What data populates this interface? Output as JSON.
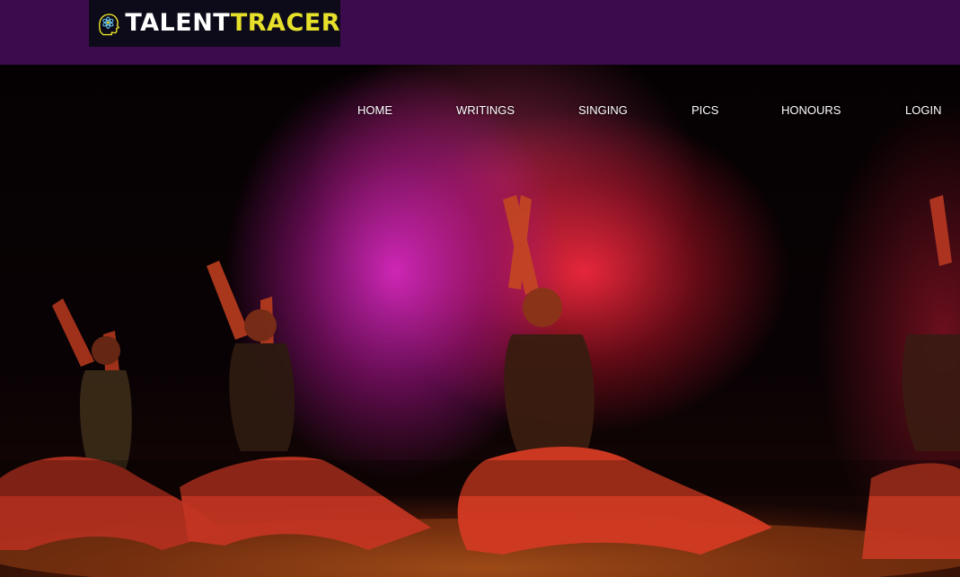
{
  "header": {
    "logo": {
      "text_part1": "TALENT",
      "text_part2": "TRACER",
      "icon": "head-atom-icon",
      "text_color": "#ffffff",
      "accent_color": "#e6e02a"
    },
    "background_color": "#3c0b4e"
  },
  "nav": {
    "items": [
      {
        "label": "HOME"
      },
      {
        "label": "WRITINGS"
      },
      {
        "label": "SINGING"
      },
      {
        "label": "PICS"
      },
      {
        "label": "HONOURS"
      },
      {
        "label": "LOGIN"
      }
    ]
  },
  "hero": {
    "image": "dancers-on-stage-with-colored-smoke"
  }
}
